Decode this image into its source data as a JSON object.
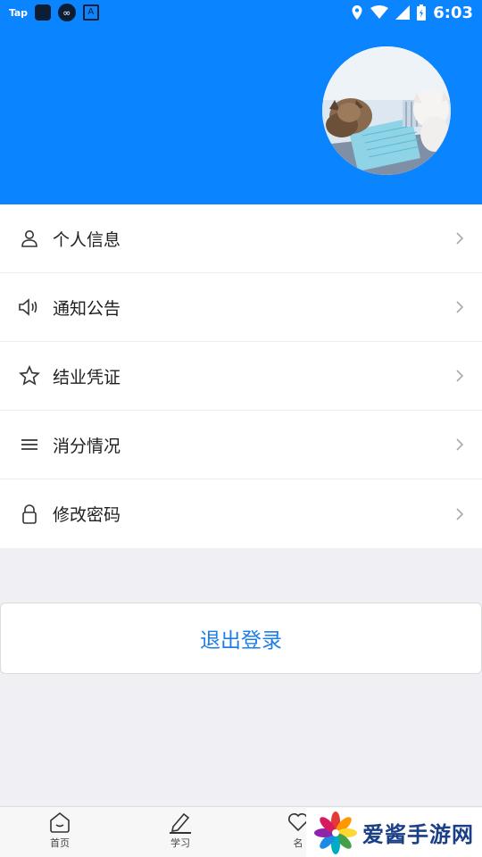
{
  "status_bar": {
    "left_label": "Tap",
    "time": "6:03"
  },
  "menu": {
    "items": [
      {
        "label": "个人信息",
        "icon": "person-icon"
      },
      {
        "label": "通知公告",
        "icon": "speaker-icon"
      },
      {
        "label": "结业凭证",
        "icon": "star-icon"
      },
      {
        "label": "消分情况",
        "icon": "list-icon"
      },
      {
        "label": "修改密码",
        "icon": "lock-icon"
      }
    ]
  },
  "logout": {
    "label": "退出登录"
  },
  "tabbar": {
    "tabs": [
      {
        "label": "首页",
        "icon": "home-icon"
      },
      {
        "label": "学习",
        "icon": "pencil-icon"
      },
      {
        "label": "名",
        "icon": "heart-icon"
      }
    ]
  },
  "watermark": {
    "text": "爱酱手游网"
  },
  "colors": {
    "header_bg": "#0a84ff",
    "accent_text": "#1e7ee8",
    "page_bg": "#efeff4"
  }
}
